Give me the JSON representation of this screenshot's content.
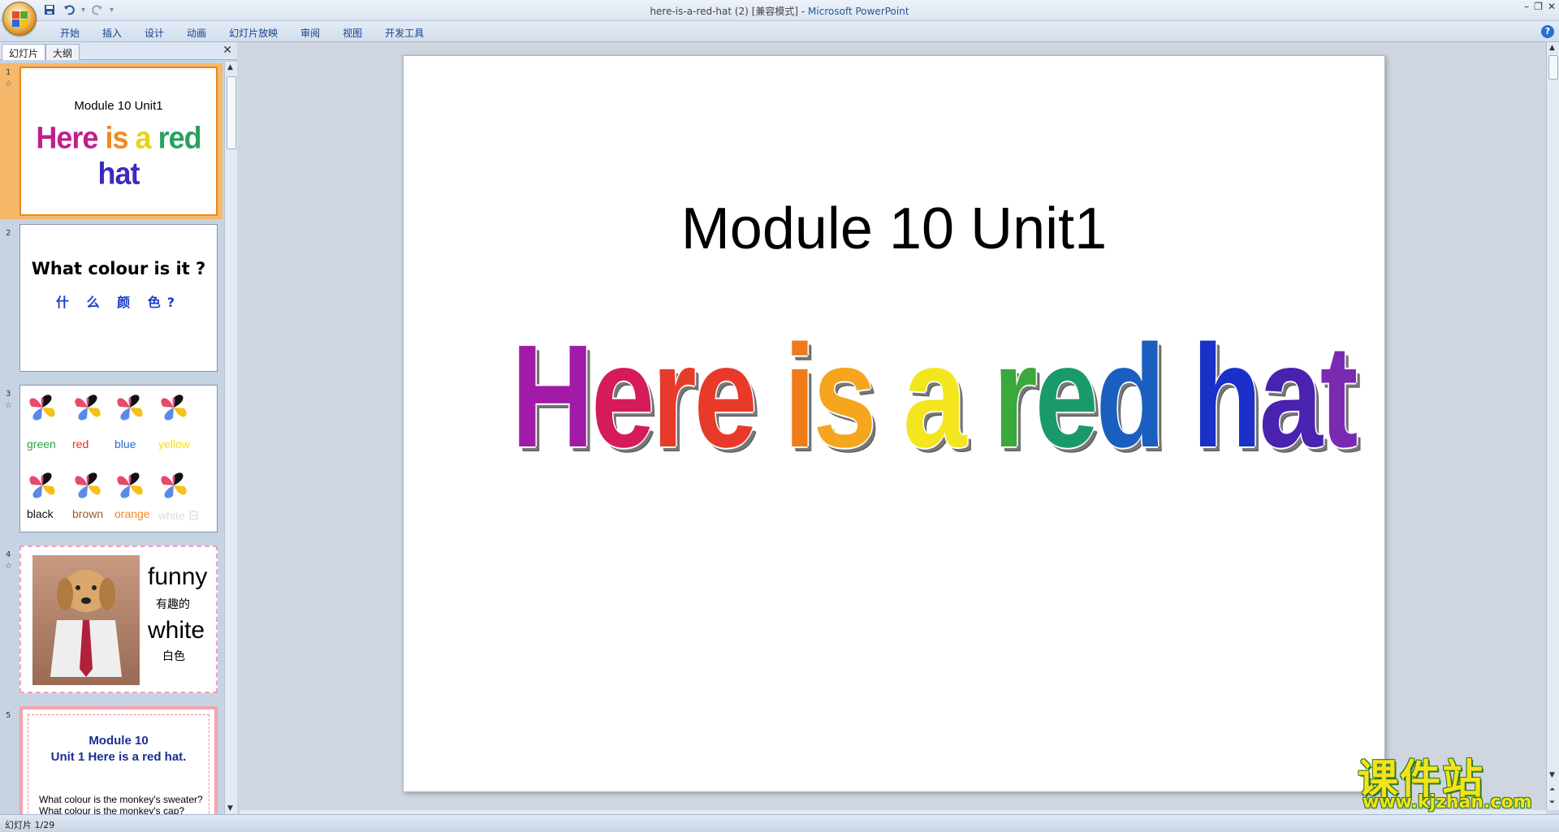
{
  "window": {
    "title": "here-is-a-red-hat (2) [兼容模式]",
    "separator": " - ",
    "app": "Microsoft PowerPoint",
    "qat_icons": [
      "save-icon",
      "undo-icon",
      "redo-icon",
      "customize-icon"
    ],
    "controls": [
      "minimize-icon",
      "restore-icon",
      "close-icon"
    ]
  },
  "ribbon": {
    "tabs": [
      "开始",
      "插入",
      "设计",
      "动画",
      "幻灯片放映",
      "审阅",
      "视图",
      "开发工具"
    ],
    "help": "?"
  },
  "pane": {
    "tabs": [
      "幻灯片",
      "大纲"
    ],
    "close": "✕"
  },
  "thumbnails": [
    {
      "num": "1",
      "title": "Module 10 Unit1",
      "wordart": "Here is a red hat"
    },
    {
      "num": "2",
      "title": "What  colour is it ?",
      "subtitle": "什 么 颜 色?"
    },
    {
      "num": "3",
      "labels": [
        "green",
        "red",
        "blue",
        "yellow",
        "black",
        "brown",
        "orange",
        "white 白"
      ]
    },
    {
      "num": "4",
      "words": [
        "funny",
        "有趣的",
        "white",
        "白色"
      ]
    },
    {
      "num": "5",
      "line1": "Module 10",
      "line2": "Unit 1 Here  is a red hat.",
      "line3": "What colour is the monkey's sweater?",
      "line4": "What colour is the monkey's cap?"
    }
  ],
  "slide": {
    "title": "Module 10 Unit1",
    "wordart_words": [
      "Here",
      "is",
      "a",
      "red",
      "hat"
    ],
    "colors": {
      "Here": [
        "#a21aa8",
        "#d61b5a",
        "#e83a2a"
      ],
      "is": [
        "#f07a18",
        "#f5a51e"
      ],
      "a": [
        "#f3e61e"
      ],
      "red": [
        "#3aa83a",
        "#1a9a6a",
        "#1a5fc0"
      ],
      "hat": [
        "#1a30c8",
        "#4a22b0",
        "#7a2ab0"
      ]
    }
  },
  "status": {
    "slide_indicator": "幻灯片 1/29"
  },
  "watermark": {
    "cn": "课件站",
    "url": "www.kjzhan.com"
  }
}
